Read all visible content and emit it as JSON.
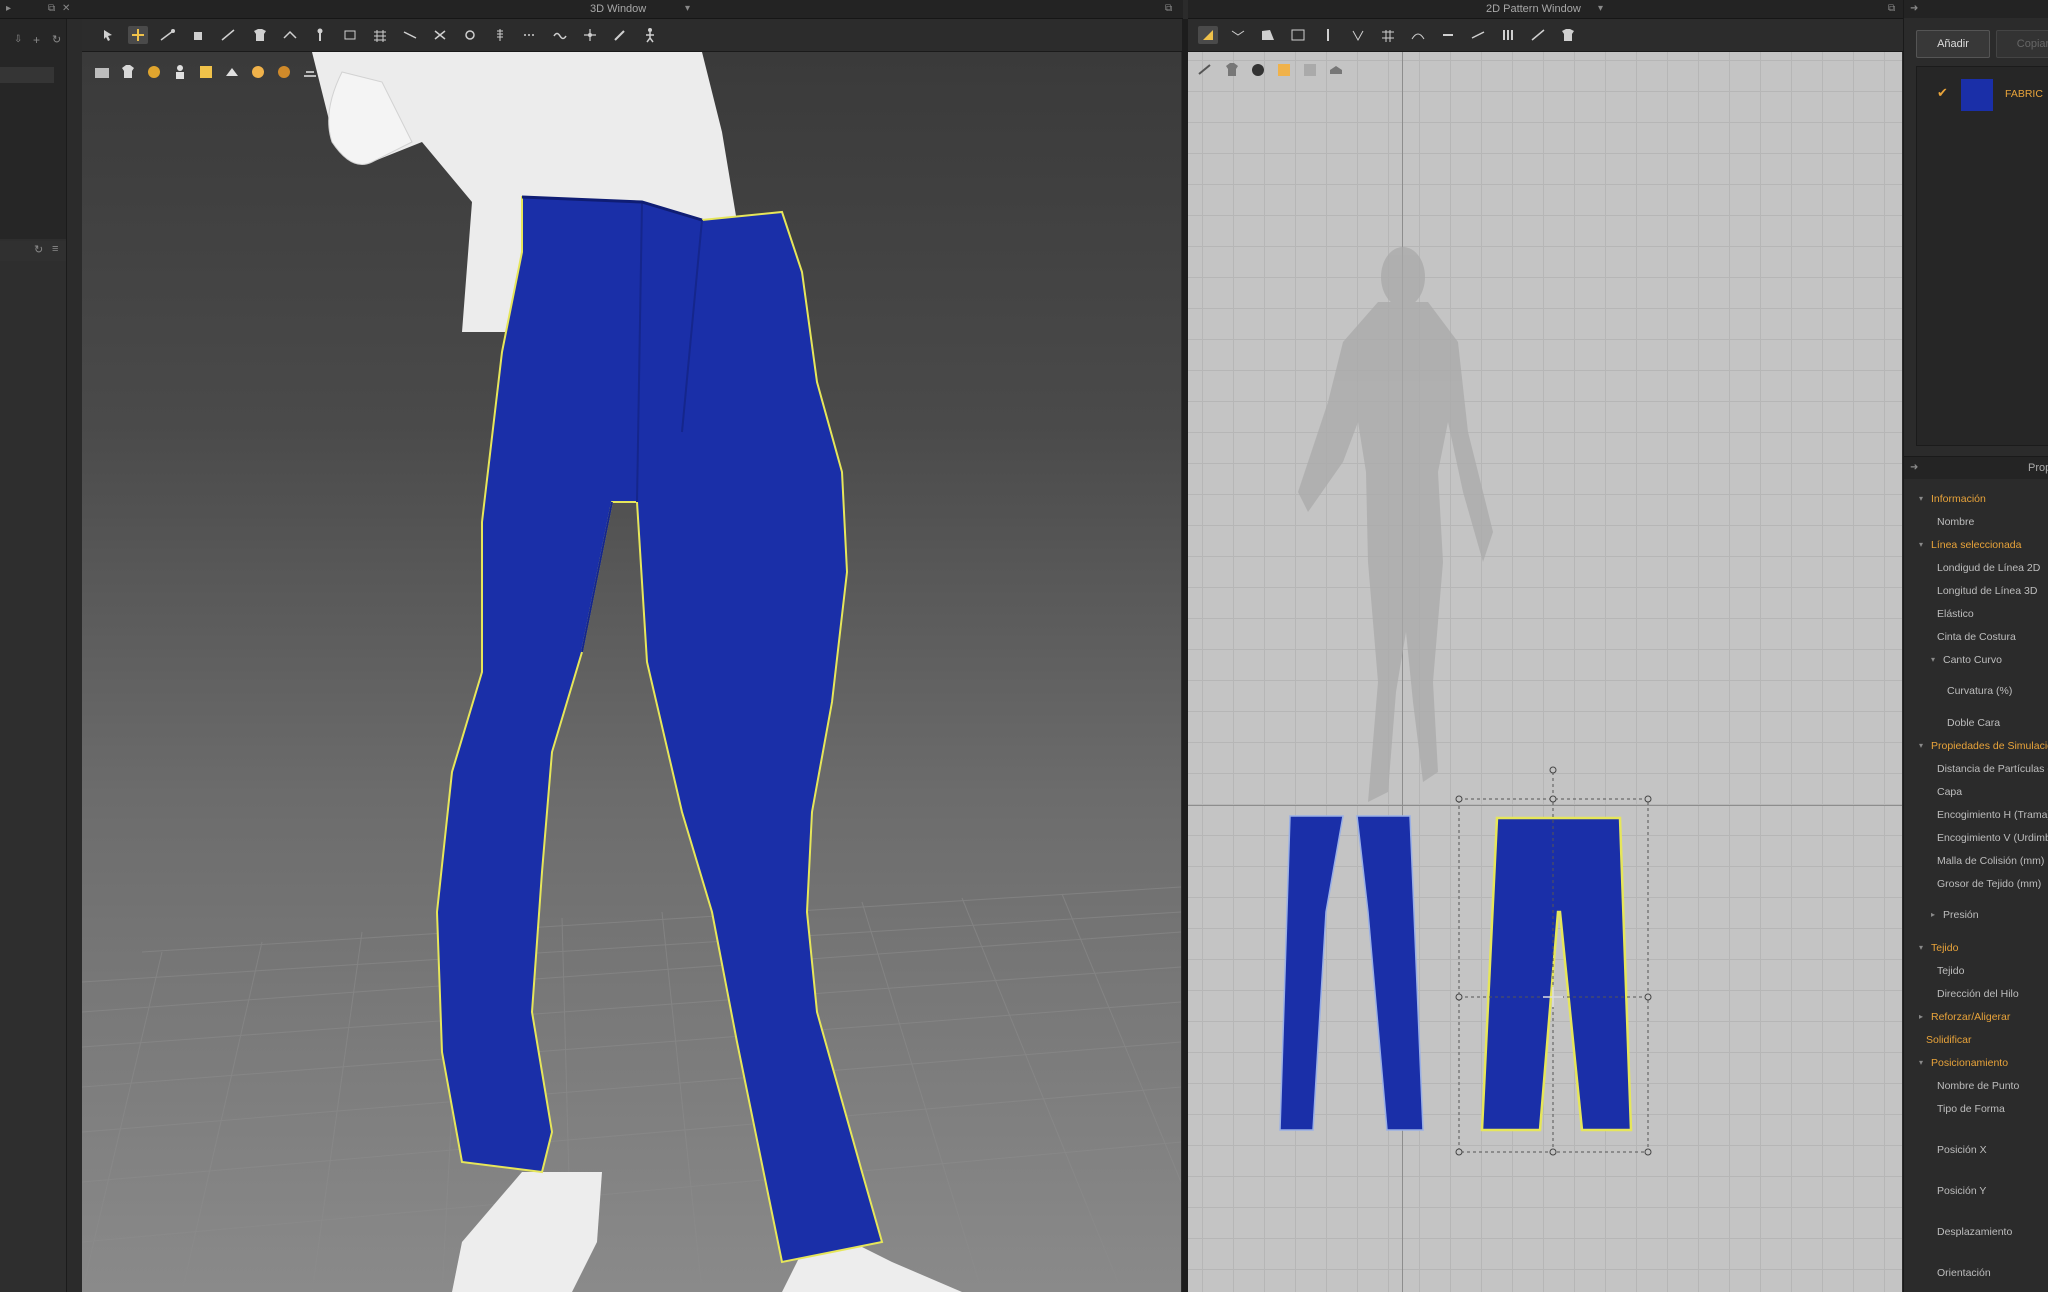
{
  "window_3d": {
    "title": "3D Window"
  },
  "window_2d": {
    "title": "2D Pattern Window"
  },
  "fabric_panel": {
    "add_button": "Añadir",
    "copy_button": "Copiar",
    "fabric_name": "FABRIC",
    "fabric_color": "#1a2fa8",
    "checked": true
  },
  "property_editor": {
    "title": "Prop",
    "rows": [
      {
        "label": "Información",
        "type": "section",
        "arrow": "▾",
        "indent": 0
      },
      {
        "label": "Nombre",
        "type": "item",
        "indent": 1
      },
      {
        "label": "Línea seleccionada",
        "type": "section",
        "arrow": "▾",
        "indent": 0
      },
      {
        "label": "Londigud de Línea 2D",
        "type": "item",
        "indent": 1
      },
      {
        "label": "Longitud de Línea 3D",
        "type": "item",
        "indent": 1
      },
      {
        "label": "Elástico",
        "type": "item",
        "indent": 1
      },
      {
        "label": "Cinta de Costura",
        "type": "item",
        "indent": 1
      },
      {
        "label": "Canto Curvo",
        "type": "item",
        "arrow": "▾",
        "indent": 2
      },
      {
        "label": "Curvatura (%)",
        "type": "item",
        "indent": 3
      },
      {
        "label": "Doble Cara",
        "type": "item",
        "indent": 3
      },
      {
        "label": "Propiedades de Simulación",
        "type": "section",
        "arrow": "▾",
        "indent": 0
      },
      {
        "label": "Distancia de Partículas (",
        "type": "item",
        "indent": 1
      },
      {
        "label": "Capa",
        "type": "item",
        "indent": 1
      },
      {
        "label": "Encogimiento H (Trama)",
        "type": "item",
        "indent": 1
      },
      {
        "label": "Encogimiento V (Urdimbr",
        "type": "item",
        "indent": 1
      },
      {
        "label": "Malla de Colisión (mm)",
        "type": "item",
        "indent": 1
      },
      {
        "label": "Grosor de Tejido (mm)",
        "type": "item",
        "indent": 1
      },
      {
        "label": "Presión",
        "type": "item",
        "arrow": "▸",
        "indent": 2
      },
      {
        "label": "Tejido",
        "type": "section",
        "arrow": "▾",
        "indent": 0
      },
      {
        "label": "Tejido",
        "type": "item",
        "indent": 1
      },
      {
        "label": "Dirección del Hilo",
        "type": "item",
        "indent": 1
      },
      {
        "label": "Reforzar/Aligerar",
        "type": "section",
        "arrow": "▸",
        "indent": 0
      },
      {
        "label": "Solidificar",
        "type": "section",
        "indent": -1
      },
      {
        "label": "Posicionamiento",
        "type": "section",
        "arrow": "▾",
        "indent": 0
      },
      {
        "label": "Nombre de Punto",
        "type": "item",
        "indent": 1
      },
      {
        "label": "Tipo de Forma",
        "type": "item",
        "indent": 1
      },
      {
        "label": "Posición X",
        "type": "item",
        "indent": 1
      },
      {
        "label": "Posición Y",
        "type": "item",
        "indent": 1
      },
      {
        "label": "Desplazamiento",
        "type": "item",
        "indent": 1
      },
      {
        "label": "Orientación",
        "type": "item",
        "indent": 1
      }
    ]
  },
  "colors": {
    "accent": "#e8a33a",
    "garment": "#1a2fa8",
    "selection_outline": "#e6e65a",
    "highlight_toolbar": "#f0c24a"
  }
}
